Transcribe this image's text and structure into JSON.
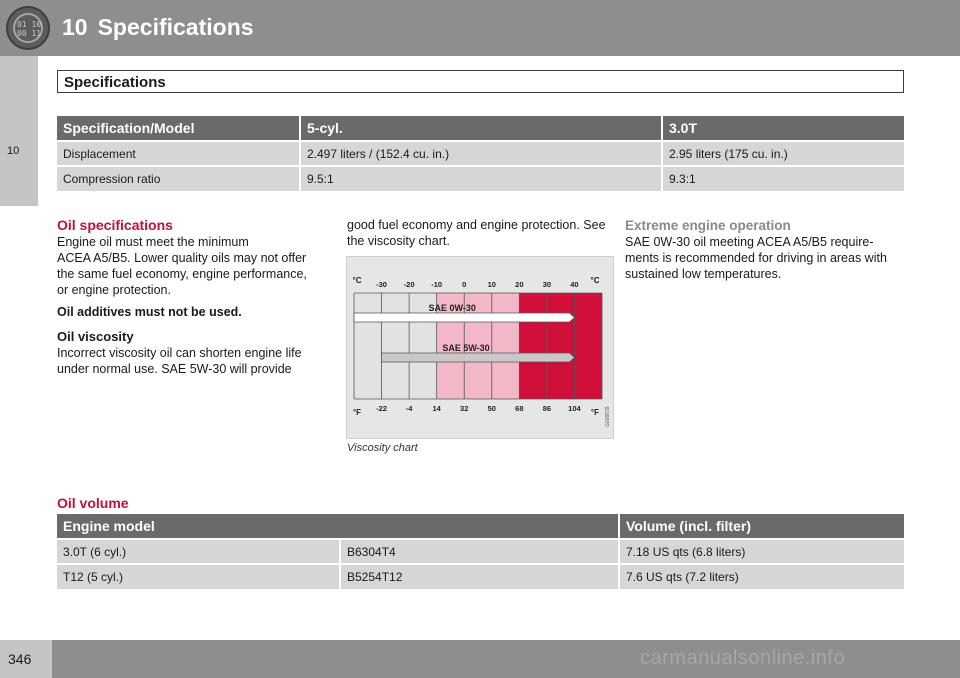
{
  "header": {
    "chapter_number": "10",
    "chapter_title": "Specifications",
    "icon_digits_top": "01 10",
    "icon_digits_bottom": "00 11"
  },
  "side_tab": {
    "chapter_number": "10"
  },
  "section": {
    "title": "Specifications"
  },
  "spec_table": {
    "headers": [
      "Specification/Model",
      "5-cyl.",
      "3.0T"
    ],
    "rows": [
      [
        "Displacement",
        "2.497 liters / (152.4 cu. in.)",
        "2.95 liters (175 cu. in.)"
      ],
      [
        "Compression ratio",
        "9.5:1",
        "9.3:1"
      ]
    ]
  },
  "oil_spec": {
    "heading": "Oil specifications",
    "p1_l1": "Engine oil must meet the minimum",
    "p1_l2": "ACEA A5/B5. Lower quality oils may not offer",
    "p1_l3": "the same fuel economy, engine performance,",
    "p1_l4": "or engine protection.",
    "bold_note": "Oil additives must not be used.",
    "viscosity_heading": "Oil viscosity",
    "v_l1": "Incorrect viscosity oil can shorten engine life",
    "v_l2": "under normal use. SAE 5W-30 will provide",
    "v_l3": "good fuel economy and engine protection. See",
    "v_l4": "the viscosity chart."
  },
  "extreme": {
    "heading": "Extreme engine operation",
    "l1": "SAE 0W-30 oil meeting ACEA A5/B5 require-",
    "l2": "ments is recommended for driving in areas with",
    "l3": "sustained low temperatures."
  },
  "chart_data": {
    "type": "bar",
    "title": "",
    "caption": "Viscosity chart",
    "code": "G026678",
    "unit_c": "°C",
    "unit_f": "°F",
    "c_ticks": [
      "-30",
      "-20",
      "-10",
      "0",
      "10",
      "20",
      "30",
      "40"
    ],
    "f_ticks": [
      "-22",
      "-4",
      "14",
      "32",
      "50",
      "68",
      "86",
      "104"
    ],
    "xlim_c": [
      -40,
      50
    ],
    "series": [
      {
        "name": "SAE 0W-30",
        "from_c": -40,
        "to_c": 40
      },
      {
        "name": "SAE 5W-30",
        "from_c": -30,
        "to_c": 40
      }
    ],
    "zones": [
      {
        "from_c": -40,
        "to_c": -10,
        "color": "#e2e2e2"
      },
      {
        "from_c": -10,
        "to_c": 20,
        "color": "#f2b8c8"
      },
      {
        "from_c": 20,
        "to_c": 50,
        "color": "#d0103a"
      }
    ]
  },
  "oil_volume": {
    "heading": "Oil volume",
    "headers": [
      "Engine model",
      "Volume (incl. filter)"
    ],
    "rows": [
      [
        "3.0T (6 cyl.)",
        "B6304T4",
        "7.18 US qts (6.8 liters)"
      ],
      [
        "T12 (5 cyl.)",
        "B5254T12",
        "7.6 US qts (7.2 liters)"
      ]
    ]
  },
  "footer": {
    "page_number": "346",
    "watermark": "carmanualsonline.info"
  }
}
